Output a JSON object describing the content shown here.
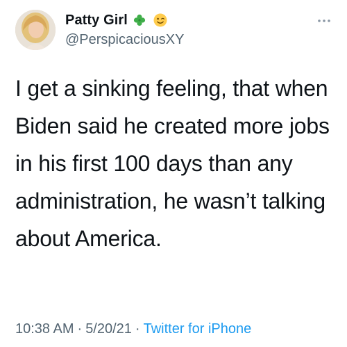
{
  "tweet": {
    "display_name": "Patty Girl",
    "handle": "@PerspicaciousXY",
    "name_emojis": [
      "four-leaf-clover-icon",
      "winking-face-icon"
    ],
    "text": "I get a sinking feeling, that when Biden said he created more jobs in his first 100 days than any administration, he wasn’t talking about America.",
    "time": "10:38 AM",
    "date": "5/20/21",
    "separator": "·",
    "source": "Twitter for iPhone"
  },
  "colors": {
    "text_primary": "#0f1419",
    "text_secondary": "#536471",
    "link": "#1d9bf0",
    "clover": "#3fae49",
    "wink": "#ffcc4d"
  }
}
